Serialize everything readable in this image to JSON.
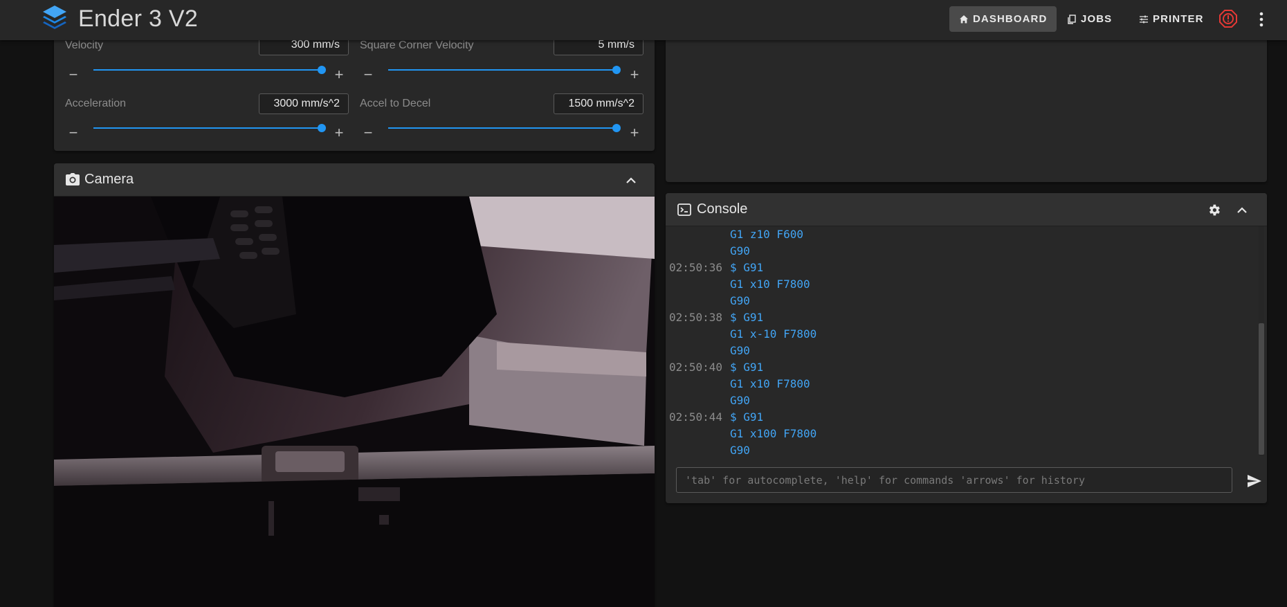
{
  "app": {
    "title": "Ender 3 V2"
  },
  "nav": {
    "dashboard": "DASHBOARD",
    "jobs": "JOBS",
    "printer": "PRINTER"
  },
  "tuning": {
    "velocity": {
      "label": "Velocity",
      "value": "300 mm/s",
      "level": 1.0
    },
    "square_corner_velocity": {
      "label": "Square Corner Velocity",
      "value": "5 mm/s",
      "level": 1.0
    },
    "acceleration": {
      "label": "Acceleration",
      "value": "3000 mm/s^2",
      "level": 1.0
    },
    "accel_to_decel": {
      "label": "Accel to Decel",
      "value": "1500 mm/s^2",
      "level": 1.0
    }
  },
  "camera": {
    "title": "Camera"
  },
  "console": {
    "title": "Console",
    "placeholder": "'tab' for autocomplete, 'help' for commands 'arrows' for history",
    "lines": [
      {
        "time": "",
        "cmd": "G1 z10 F600"
      },
      {
        "time": "",
        "cmd": "G90"
      },
      {
        "time": "02:50:36",
        "cmd": "$ G91"
      },
      {
        "time": "",
        "cmd": "G1 x10 F7800"
      },
      {
        "time": "",
        "cmd": "G90"
      },
      {
        "time": "02:50:38",
        "cmd": "$ G91"
      },
      {
        "time": "",
        "cmd": "G1 x-10 F7800"
      },
      {
        "time": "",
        "cmd": "G90"
      },
      {
        "time": "02:50:40",
        "cmd": "$ G91"
      },
      {
        "time": "",
        "cmd": "G1 x10 F7800"
      },
      {
        "time": "",
        "cmd": "G90"
      },
      {
        "time": "02:50:44",
        "cmd": "$ G91"
      },
      {
        "time": "",
        "cmd": "G1 x100 F7800"
      },
      {
        "time": "",
        "cmd": "G90"
      }
    ]
  },
  "colors": {
    "accent": "#2196f3",
    "estop": "#e53935",
    "console_cmd": "#42a5f5"
  },
  "icons": [
    "layers-logo-icon",
    "home-icon",
    "file-copy-icon",
    "tune-icon",
    "emergency-stop-icon",
    "more-vert-icon",
    "camera-icon",
    "console-icon",
    "gear-icon",
    "chevron-up-icon",
    "send-icon",
    "minus-icon",
    "plus-icon"
  ]
}
